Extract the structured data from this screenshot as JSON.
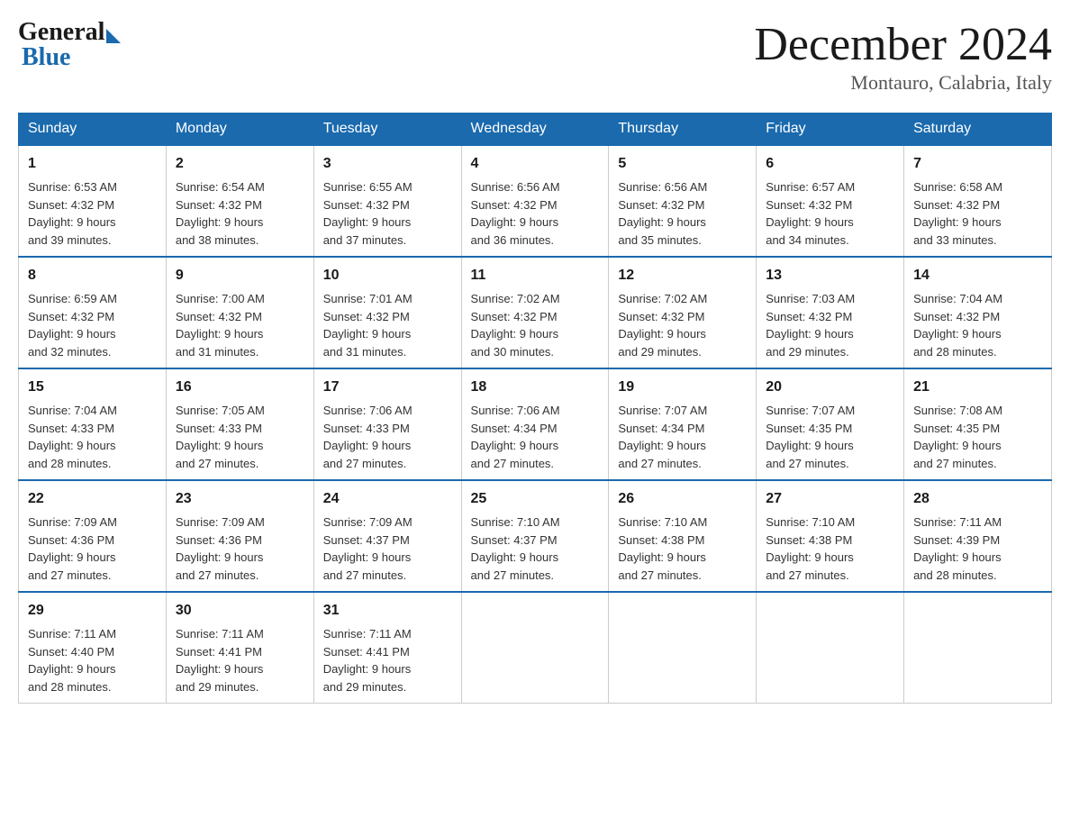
{
  "logo": {
    "general": "General",
    "blue": "Blue"
  },
  "title": "December 2024",
  "subtitle": "Montauro, Calabria, Italy",
  "days": [
    "Sunday",
    "Monday",
    "Tuesday",
    "Wednesday",
    "Thursday",
    "Friday",
    "Saturday"
  ],
  "weeks": [
    [
      {
        "day": "1",
        "sunrise": "Sunrise: 6:53 AM",
        "sunset": "Sunset: 4:32 PM",
        "daylight": "Daylight: 9 hours",
        "daylight2": "and 39 minutes."
      },
      {
        "day": "2",
        "sunrise": "Sunrise: 6:54 AM",
        "sunset": "Sunset: 4:32 PM",
        "daylight": "Daylight: 9 hours",
        "daylight2": "and 38 minutes."
      },
      {
        "day": "3",
        "sunrise": "Sunrise: 6:55 AM",
        "sunset": "Sunset: 4:32 PM",
        "daylight": "Daylight: 9 hours",
        "daylight2": "and 37 minutes."
      },
      {
        "day": "4",
        "sunrise": "Sunrise: 6:56 AM",
        "sunset": "Sunset: 4:32 PM",
        "daylight": "Daylight: 9 hours",
        "daylight2": "and 36 minutes."
      },
      {
        "day": "5",
        "sunrise": "Sunrise: 6:56 AM",
        "sunset": "Sunset: 4:32 PM",
        "daylight": "Daylight: 9 hours",
        "daylight2": "and 35 minutes."
      },
      {
        "day": "6",
        "sunrise": "Sunrise: 6:57 AM",
        "sunset": "Sunset: 4:32 PM",
        "daylight": "Daylight: 9 hours",
        "daylight2": "and 34 minutes."
      },
      {
        "day": "7",
        "sunrise": "Sunrise: 6:58 AM",
        "sunset": "Sunset: 4:32 PM",
        "daylight": "Daylight: 9 hours",
        "daylight2": "and 33 minutes."
      }
    ],
    [
      {
        "day": "8",
        "sunrise": "Sunrise: 6:59 AM",
        "sunset": "Sunset: 4:32 PM",
        "daylight": "Daylight: 9 hours",
        "daylight2": "and 32 minutes."
      },
      {
        "day": "9",
        "sunrise": "Sunrise: 7:00 AM",
        "sunset": "Sunset: 4:32 PM",
        "daylight": "Daylight: 9 hours",
        "daylight2": "and 31 minutes."
      },
      {
        "day": "10",
        "sunrise": "Sunrise: 7:01 AM",
        "sunset": "Sunset: 4:32 PM",
        "daylight": "Daylight: 9 hours",
        "daylight2": "and 31 minutes."
      },
      {
        "day": "11",
        "sunrise": "Sunrise: 7:02 AM",
        "sunset": "Sunset: 4:32 PM",
        "daylight": "Daylight: 9 hours",
        "daylight2": "and 30 minutes."
      },
      {
        "day": "12",
        "sunrise": "Sunrise: 7:02 AM",
        "sunset": "Sunset: 4:32 PM",
        "daylight": "Daylight: 9 hours",
        "daylight2": "and 29 minutes."
      },
      {
        "day": "13",
        "sunrise": "Sunrise: 7:03 AM",
        "sunset": "Sunset: 4:32 PM",
        "daylight": "Daylight: 9 hours",
        "daylight2": "and 29 minutes."
      },
      {
        "day": "14",
        "sunrise": "Sunrise: 7:04 AM",
        "sunset": "Sunset: 4:32 PM",
        "daylight": "Daylight: 9 hours",
        "daylight2": "and 28 minutes."
      }
    ],
    [
      {
        "day": "15",
        "sunrise": "Sunrise: 7:04 AM",
        "sunset": "Sunset: 4:33 PM",
        "daylight": "Daylight: 9 hours",
        "daylight2": "and 28 minutes."
      },
      {
        "day": "16",
        "sunrise": "Sunrise: 7:05 AM",
        "sunset": "Sunset: 4:33 PM",
        "daylight": "Daylight: 9 hours",
        "daylight2": "and 27 minutes."
      },
      {
        "day": "17",
        "sunrise": "Sunrise: 7:06 AM",
        "sunset": "Sunset: 4:33 PM",
        "daylight": "Daylight: 9 hours",
        "daylight2": "and 27 minutes."
      },
      {
        "day": "18",
        "sunrise": "Sunrise: 7:06 AM",
        "sunset": "Sunset: 4:34 PM",
        "daylight": "Daylight: 9 hours",
        "daylight2": "and 27 minutes."
      },
      {
        "day": "19",
        "sunrise": "Sunrise: 7:07 AM",
        "sunset": "Sunset: 4:34 PM",
        "daylight": "Daylight: 9 hours",
        "daylight2": "and 27 minutes."
      },
      {
        "day": "20",
        "sunrise": "Sunrise: 7:07 AM",
        "sunset": "Sunset: 4:35 PM",
        "daylight": "Daylight: 9 hours",
        "daylight2": "and 27 minutes."
      },
      {
        "day": "21",
        "sunrise": "Sunrise: 7:08 AM",
        "sunset": "Sunset: 4:35 PM",
        "daylight": "Daylight: 9 hours",
        "daylight2": "and 27 minutes."
      }
    ],
    [
      {
        "day": "22",
        "sunrise": "Sunrise: 7:09 AM",
        "sunset": "Sunset: 4:36 PM",
        "daylight": "Daylight: 9 hours",
        "daylight2": "and 27 minutes."
      },
      {
        "day": "23",
        "sunrise": "Sunrise: 7:09 AM",
        "sunset": "Sunset: 4:36 PM",
        "daylight": "Daylight: 9 hours",
        "daylight2": "and 27 minutes."
      },
      {
        "day": "24",
        "sunrise": "Sunrise: 7:09 AM",
        "sunset": "Sunset: 4:37 PM",
        "daylight": "Daylight: 9 hours",
        "daylight2": "and 27 minutes."
      },
      {
        "day": "25",
        "sunrise": "Sunrise: 7:10 AM",
        "sunset": "Sunset: 4:37 PM",
        "daylight": "Daylight: 9 hours",
        "daylight2": "and 27 minutes."
      },
      {
        "day": "26",
        "sunrise": "Sunrise: 7:10 AM",
        "sunset": "Sunset: 4:38 PM",
        "daylight": "Daylight: 9 hours",
        "daylight2": "and 27 minutes."
      },
      {
        "day": "27",
        "sunrise": "Sunrise: 7:10 AM",
        "sunset": "Sunset: 4:38 PM",
        "daylight": "Daylight: 9 hours",
        "daylight2": "and 27 minutes."
      },
      {
        "day": "28",
        "sunrise": "Sunrise: 7:11 AM",
        "sunset": "Sunset: 4:39 PM",
        "daylight": "Daylight: 9 hours",
        "daylight2": "and 28 minutes."
      }
    ],
    [
      {
        "day": "29",
        "sunrise": "Sunrise: 7:11 AM",
        "sunset": "Sunset: 4:40 PM",
        "daylight": "Daylight: 9 hours",
        "daylight2": "and 28 minutes."
      },
      {
        "day": "30",
        "sunrise": "Sunrise: 7:11 AM",
        "sunset": "Sunset: 4:41 PM",
        "daylight": "Daylight: 9 hours",
        "daylight2": "and 29 minutes."
      },
      {
        "day": "31",
        "sunrise": "Sunrise: 7:11 AM",
        "sunset": "Sunset: 4:41 PM",
        "daylight": "Daylight: 9 hours",
        "daylight2": "and 29 minutes."
      },
      null,
      null,
      null,
      null
    ]
  ]
}
